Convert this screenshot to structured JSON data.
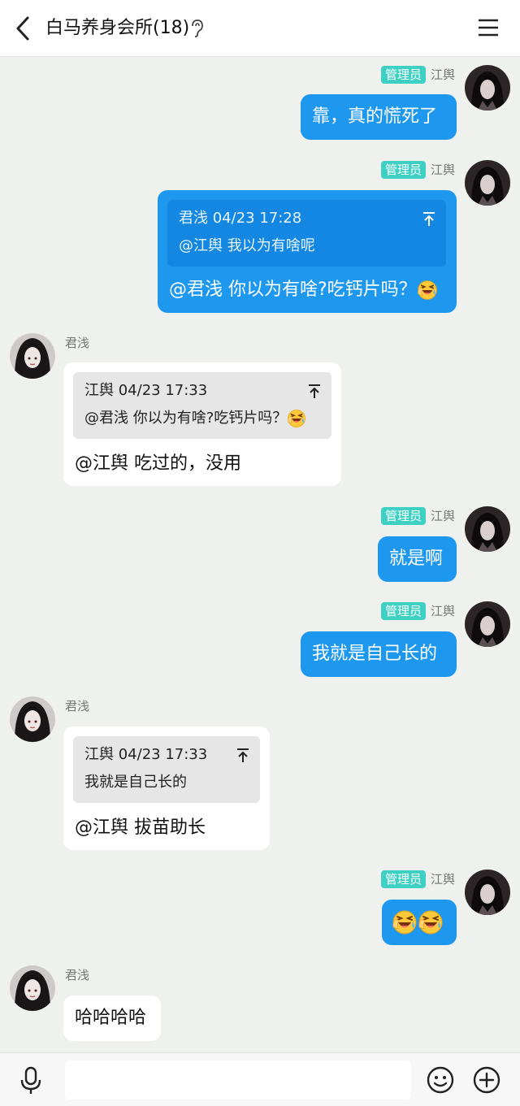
{
  "header": {
    "title": "白马养身会所(18)"
  },
  "admin_badge": "管理员",
  "messages": [
    {
      "sender": "江舆",
      "text": "靠，真的慌死了"
    },
    {
      "sender": "江舆",
      "quote_head": "君浅 04/23 17:28",
      "quote_body": "@江舆 我以为有啥呢",
      "text": "@君浅 你以为有啥?吃钙片吗？"
    },
    {
      "sender": "君浅",
      "quote_head": "江舆 04/23 17:33",
      "quote_body": "@君浅 你以为有啥?吃钙片吗？",
      "text": "@江舆 吃过的，没用"
    },
    {
      "sender": "江舆",
      "text": "就是啊"
    },
    {
      "sender": "江舆",
      "text": "我就是自己长的"
    },
    {
      "sender": "君浅",
      "quote_head": "江舆 04/23 17:33",
      "quote_body": "我就是自己长的",
      "text": "@江舆 拔苗助长"
    },
    {
      "sender": "江舆",
      "emoji": "laughing-tears-emoji"
    },
    {
      "sender": "君浅",
      "text": "哈哈哈哈"
    }
  ],
  "input": {
    "placeholder": ""
  },
  "icons": [
    "back-icon",
    "ear-icon",
    "menu-icon",
    "pin-top-icon",
    "laughing-tears-emoji",
    "mic-icon",
    "smile-icon",
    "plus-icon"
  ],
  "colors": {
    "outgoing_bubble": "#1e98ef",
    "admin_badge": "#3fd0c4",
    "background": "#eef1ee"
  }
}
